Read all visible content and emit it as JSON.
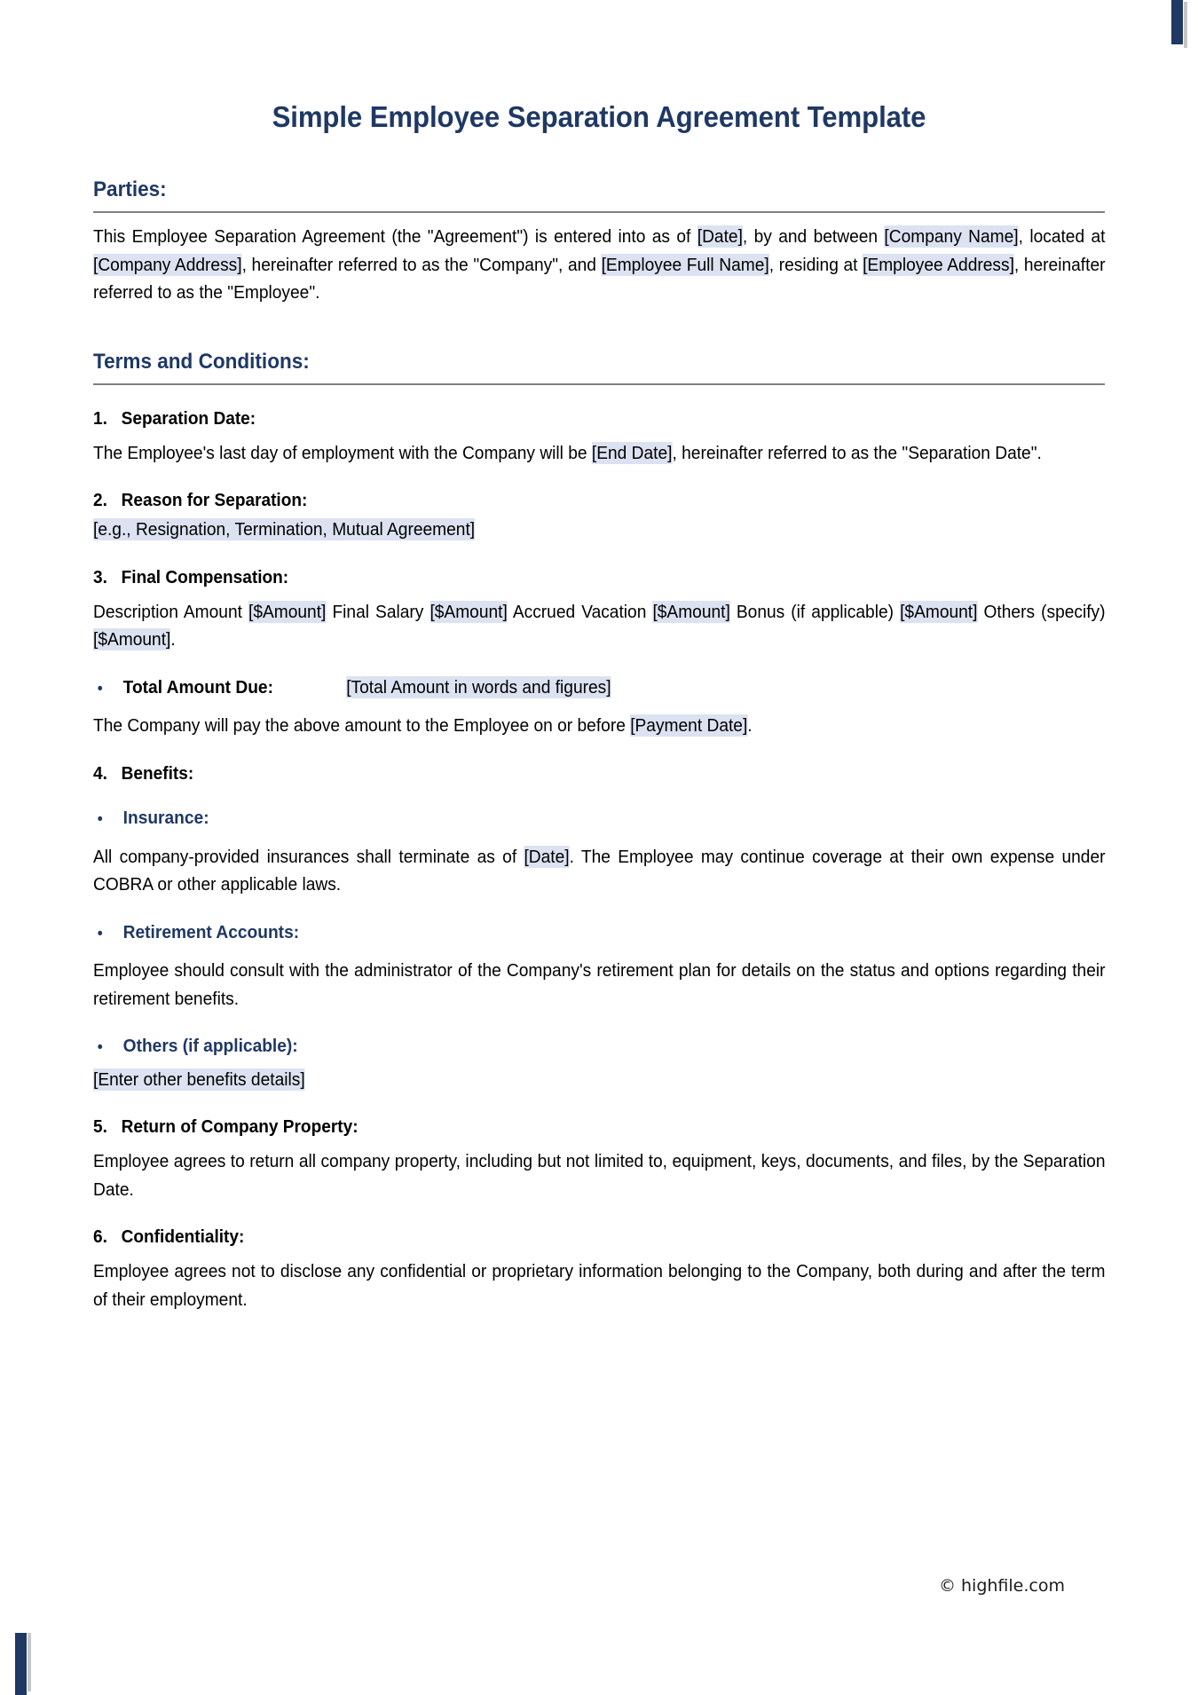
{
  "document": {
    "title": "Simple Employee Separation Agreement Template",
    "footer": "© highfile.com"
  },
  "colors": {
    "heading_navy": "#1F3864",
    "placeholder_highlight": "#DCE2F1",
    "rule_gray": "#7F7F7F",
    "body_black": "#000000"
  },
  "sections": {
    "parties": {
      "heading": "Parties:",
      "paragraph": {
        "t1": "This Employee Separation Agreement (the \"Agreement\") is entered into as of ",
        "ph1": "[Date]",
        "t2": ", by and between ",
        "ph2": "[Company Name]",
        "t3": ", located at ",
        "ph3": "[Company Address]",
        "t4": ", hereinafter referred to as the \"Company\", and ",
        "ph4": "[Employee Full Name]",
        "t5": ", residing at ",
        "ph5": "[Employee Address]",
        "t6": ", hereinafter referred to as the \"Employee\"."
      }
    },
    "terms": {
      "heading": "Terms and Conditions:",
      "items": [
        {
          "number": "1.",
          "title": "Separation Date:",
          "body": {
            "t1": "The Employee's last day of employment with the Company will be ",
            "ph1": "[End Date]",
            "t2": ", hereinafter referred to as the \"Separation Date\"."
          }
        },
        {
          "number": "2.",
          "title": "Reason for Separation:",
          "body": {
            "ph1": "[e.g., Resignation, Termination, Mutual Agreement]"
          }
        },
        {
          "number": "3.",
          "title": "Final Compensation:",
          "body": {
            "t1": "Description Amount ",
            "ph1": "[$Amount]",
            "t2": " Final Salary ",
            "ph2": "[$Amount]",
            "t3": " Accrued Vacation ",
            "ph3": "[$Amount]",
            "t4": " Bonus (if applicable) ",
            "ph4": "[$Amount]",
            "t5": " Others (specify) ",
            "ph5": "[$Amount]",
            "t6": "."
          },
          "bullet": {
            "label": "Total Amount Due",
            "colon": ":",
            "ph": "[Total Amount in words and figures]"
          },
          "closing": {
            "t1": "The Company will pay the above amount to the Employee on or before ",
            "ph1": "[Payment Date]",
            "t2": "."
          }
        },
        {
          "number": "4.",
          "title": "Benefits:",
          "subitems": [
            {
              "label": "Insurance:",
              "body": {
                "t1": "All company-provided insurances shall terminate as of ",
                "ph1": "[Date]",
                "t2": ". The Employee may continue coverage at their own expense under COBRA or other applicable laws."
              }
            },
            {
              "label": "Retirement Accounts:",
              "body": {
                "t1": "Employee should consult with the administrator of the Company's retirement plan for details on the status and options regarding their retirement benefits."
              }
            },
            {
              "label": "Others (if applicable):",
              "body": {
                "ph1": "[Enter other benefits details]"
              }
            }
          ]
        },
        {
          "number": "5.",
          "title": "Return of Company Property:",
          "body": {
            "t1": "Employee agrees to return all company property, including but not limited to, equipment, keys, documents, and files, by the Separation Date."
          }
        },
        {
          "number": "6.",
          "title": "Confidentiality:",
          "body": {
            "t1": "Employee agrees not to disclose any confidential or proprietary information belonging to the Company, both during and after the term of their employment."
          }
        }
      ]
    }
  },
  "icons": {
    "bullet_dot": "•"
  }
}
